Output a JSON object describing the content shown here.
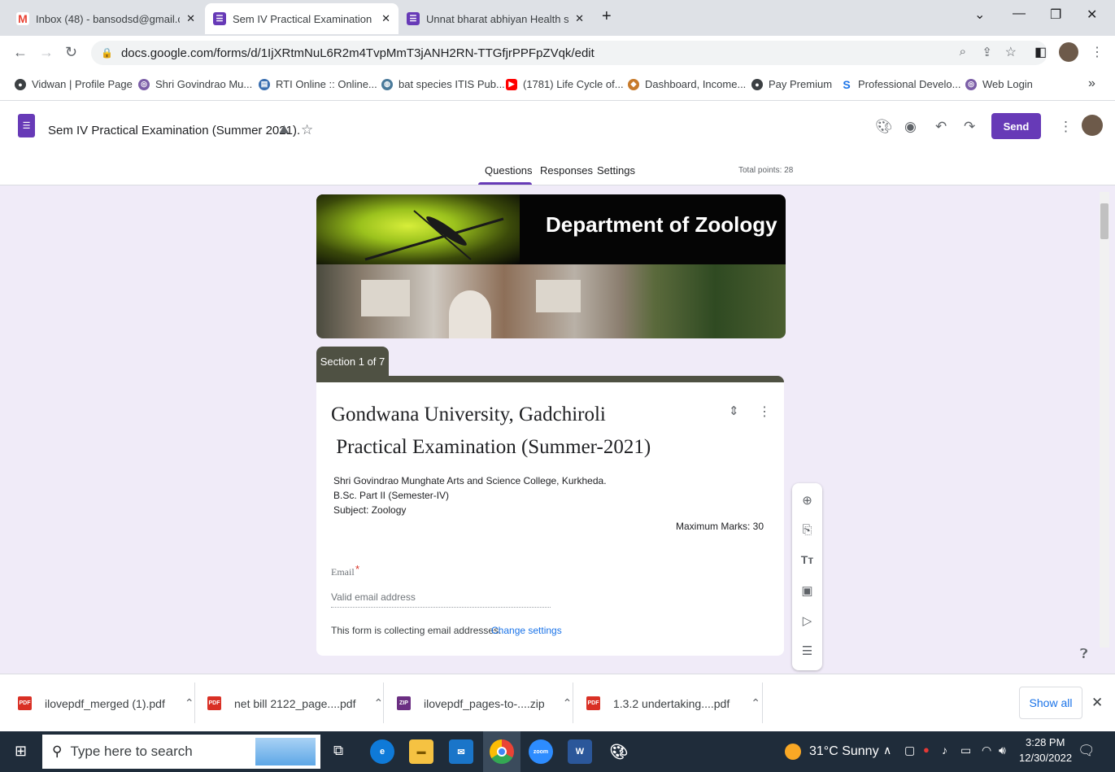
{
  "browser": {
    "tabs": [
      {
        "title": "Inbox (48) - bansodsd@gmail.co",
        "active": false
      },
      {
        "title": "Sem IV Practical Examination (Su",
        "active": true
      },
      {
        "title": "Unnat bharat abhiyan Health sur",
        "active": false
      }
    ],
    "new_tab_label": "+",
    "url": "docs.google.com/forms/d/1IjXRtmNuL6R2m4TvpMmT3jANH2RN-TTGfjrPPFpZVqk/edit",
    "bookmarks": [
      "Vidwan | Profile Page",
      "Shri Govindrao Mu...",
      "RTI Online :: Online...",
      "bat species ITIS Pub...",
      "(1781) Life Cycle of...",
      "Dashboard, Income...",
      "Pay Premium",
      "Professional Develo...",
      "Web Login"
    ],
    "bookmarks_more": "»"
  },
  "forms_header": {
    "doc_title": "Sem IV  Practical Examination (Summer 2021).",
    "send_label": "Send",
    "tabs": [
      "Questions",
      "Responses",
      "Settings"
    ],
    "total_points": "Total points: 28"
  },
  "banner": {
    "title": "Department of Zoology"
  },
  "section": {
    "label": "Section 1 of 7"
  },
  "form_card": {
    "title_line1": "Gondwana University, Gadchiroli",
    "title_line2": " Practical Examination (Summer-2021)",
    "desc_line1": "Shri Govindrao Munghate Arts and Science College, Kurkheda.",
    "desc_line2": "B.Sc. Part II (Semester-IV)",
    "desc_line3": "Subject: Zoology",
    "max_marks": "Maximum Marks: 30",
    "email_label": "Email",
    "required_mark": "*",
    "email_placeholder": "Valid email address",
    "collecting_note": "This form is collecting email addresses.",
    "change_settings": "Change settings"
  },
  "downloads": {
    "items": [
      "ilovepdf_merged (1).pdf",
      "net bill 2122_page....pdf",
      "ilovepdf_pages-to-....zip",
      "1.3.2 undertaking....pdf"
    ],
    "show_all": "Show all"
  },
  "taskbar": {
    "search_placeholder": "Type here to search",
    "weather": "31°C  Sunny",
    "time": "3:28 PM",
    "date": "12/30/2022"
  },
  "colors": {
    "accent": "#673ab7",
    "section": "#4f5143",
    "link": "#1a73e8",
    "required": "#d93025"
  }
}
